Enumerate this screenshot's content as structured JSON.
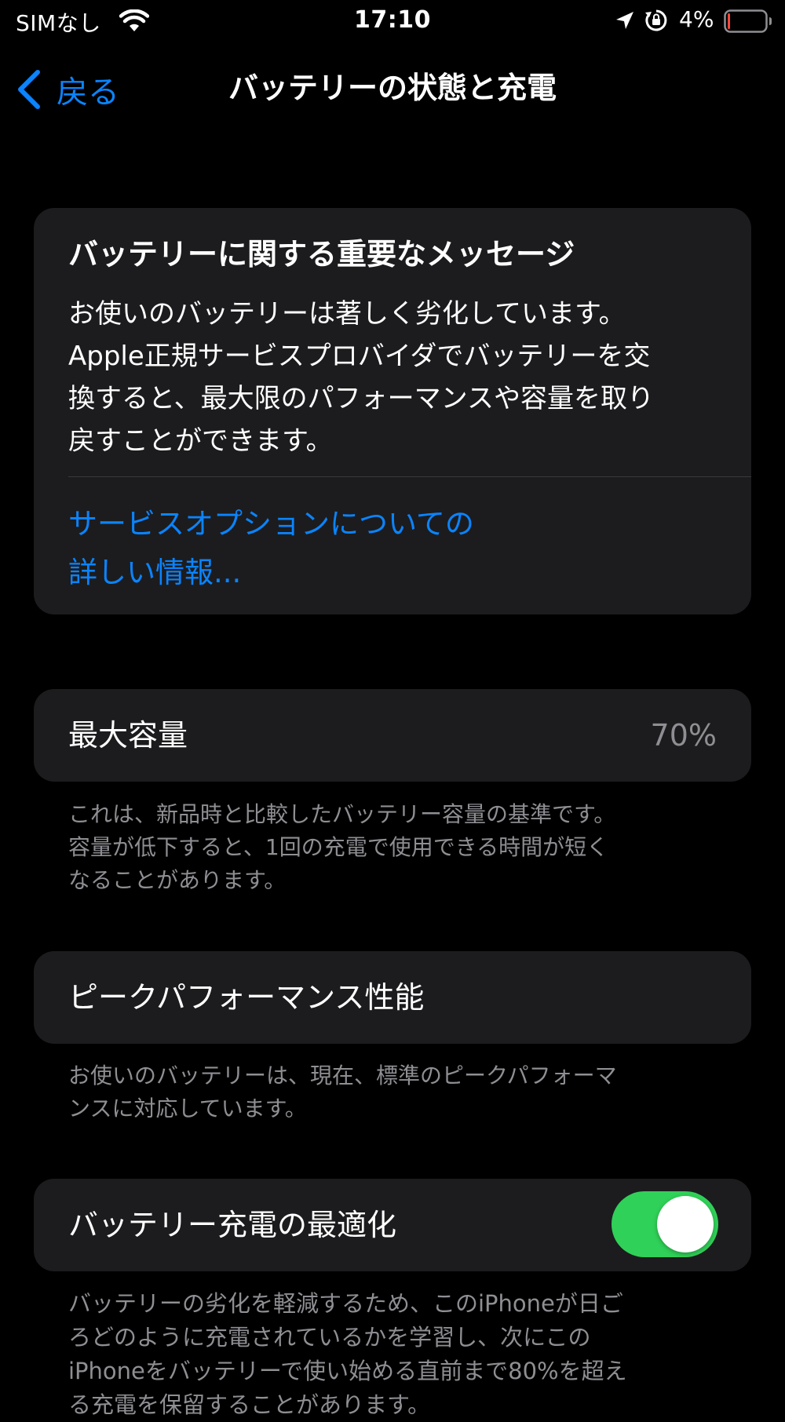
{
  "status_bar": {
    "carrier": "SIMなし",
    "time": "17:10",
    "battery_percent": "4%",
    "battery_level": 0.04,
    "icons": [
      "wifi-icon",
      "location-arrow-icon",
      "orientation-lock-icon",
      "battery-icon"
    ]
  },
  "nav": {
    "back_label": "戻る",
    "title": "バッテリーの状態と充電"
  },
  "important_message": {
    "title": "バッテリーに関する重要なメッセージ",
    "body": "お使いのバッテリーは著しく劣化しています。\nApple正規サービスプロバイダでバッテリーを交\n換すると、最大限のパフォーマンスや容量を取り\n戻すことができます。",
    "link": "サービスオプションについての\n詳しい情報..."
  },
  "max_capacity": {
    "label": "最大容量",
    "value": "70%",
    "note": "これは、新品時と比較したバッテリー容量の基準です。\n容量が低下すると、1回の充電で使用できる時間が短く\nなることがあります。"
  },
  "peak_performance": {
    "label": "ピークパフォーマンス性能",
    "note": "お使いのバッテリーは、現在、標準のピークパフォーマ\nンスに対応しています。"
  },
  "optimized_charging": {
    "label": "バッテリー充電の最適化",
    "enabled": true,
    "note": "バッテリーの劣化を軽減するため、このiPhoneが日ご\nろどのように充電されているかを学習し、次にこの\niPhoneをバッテリーで使い始める直前まで80%を超え\nる充電を保留することがあります。"
  },
  "colors": {
    "background": "#000000",
    "card": "#1c1c1e",
    "accent_blue": "#0a84ff",
    "toggle_on": "#30d158",
    "secondary_text": "#8e8e93",
    "battery_low": "#ff453a"
  }
}
